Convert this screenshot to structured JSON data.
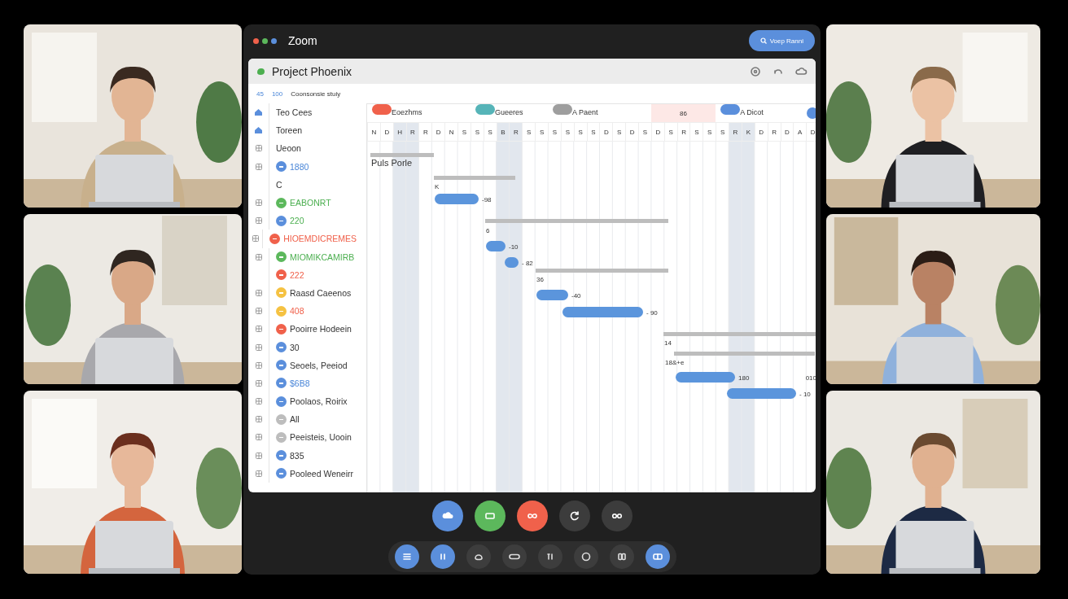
{
  "app": {
    "title": "Zoom",
    "action_button": "Voep Ranni"
  },
  "project": {
    "title": "Project Phoenix",
    "breadcrumb": [
      {
        "text": "45",
        "kind": "link"
      },
      {
        "text": "100",
        "kind": "link"
      },
      {
        "text": "Coonsonsie stuiy",
        "kind": "plain"
      }
    ]
  },
  "task_list": [
    {
      "label": "Teo Cees",
      "kind": "plain",
      "icon": true
    },
    {
      "label": "Toreen",
      "kind": "plain",
      "icon": true
    },
    {
      "label": "Ueoon",
      "kind": "plain",
      "icon": true
    },
    {
      "label": "1880",
      "kind": "link",
      "icon": true,
      "color": "#5b8fdc"
    },
    {
      "label": "C",
      "kind": "plain",
      "icon": false
    },
    {
      "label": "EABONRT",
      "kind": "success",
      "icon": true,
      "color": "#5cb85c"
    },
    {
      "label": "220",
      "kind": "success",
      "icon": true,
      "color": "#5b8fdc"
    },
    {
      "label": "HIOEMDICREMES",
      "kind": "alert",
      "icon": true,
      "color": "#f0614b"
    },
    {
      "label": "MIOMIKCAMIRB",
      "kind": "success",
      "icon": true,
      "color": "#5cb85c"
    },
    {
      "label": "222",
      "kind": "alert",
      "icon": false,
      "color": "#f0614b"
    },
    {
      "label": "Raasd Caeenos",
      "kind": "plain",
      "icon": true,
      "color": "#f5c242"
    },
    {
      "label": "408",
      "kind": "alert",
      "icon": true,
      "color": "#f5c242"
    },
    {
      "label": "Pooirre Hodeein",
      "kind": "plain",
      "icon": true,
      "color": "#f0614b"
    },
    {
      "label": "30",
      "kind": "plain",
      "icon": true,
      "color": "#5b8fdc"
    },
    {
      "label": "Seoels, Peeiod",
      "kind": "plain",
      "icon": true,
      "color": "#5b8fdc"
    },
    {
      "label": "$6B8",
      "kind": "link",
      "icon": true,
      "color": "#5b8fdc"
    },
    {
      "label": "Poolaos, Roirix",
      "kind": "plain",
      "icon": true,
      "color": "#5b8fdc"
    },
    {
      "label": "All",
      "kind": "plain",
      "icon": true,
      "color": "#bdbdbd"
    },
    {
      "label": "Peeisteis, Uooin",
      "kind": "plain",
      "icon": true,
      "color": "#bdbdbd"
    },
    {
      "label": "835",
      "kind": "plain",
      "icon": true,
      "color": "#5b8fdc"
    },
    {
      "label": "Pooleed Weneirr",
      "kind": "plain",
      "icon": true,
      "color": "#5b8fdc"
    }
  ],
  "gantt": {
    "groups": [
      {
        "kind": "pill",
        "label": "Eoezhms",
        "color": "#f0614b"
      },
      {
        "kind": "pill",
        "label": "Gueeres",
        "color": "#56b4b8"
      },
      {
        "kind": "pill",
        "label": "A Paent",
        "color": "#9e9e9e"
      },
      {
        "kind": "highlight",
        "label": "86"
      },
      {
        "kind": "pill",
        "label": "A Dicot",
        "color": "#5b8fdc"
      },
      {
        "kind": "dot",
        "color": "#5b8fdc"
      }
    ],
    "days": [
      {
        "label": "N",
        "weekend": false
      },
      {
        "label": "D",
        "weekend": false
      },
      {
        "label": "H",
        "weekend": true
      },
      {
        "label": "R",
        "weekend": true
      },
      {
        "label": "R",
        "weekend": false
      },
      {
        "label": "D",
        "weekend": false
      },
      {
        "label": "N",
        "weekend": false
      },
      {
        "label": "S",
        "weekend": false
      },
      {
        "label": "S",
        "weekend": false
      },
      {
        "label": "S",
        "weekend": false
      },
      {
        "label": "B",
        "weekend": true
      },
      {
        "label": "R",
        "weekend": true
      },
      {
        "label": "S",
        "weekend": false
      },
      {
        "label": "S",
        "weekend": false
      },
      {
        "label": "S",
        "weekend": false
      },
      {
        "label": "S",
        "weekend": false
      },
      {
        "label": "S",
        "weekend": false
      },
      {
        "label": "S",
        "weekend": false
      },
      {
        "label": "D",
        "weekend": false
      },
      {
        "label": "S",
        "weekend": false
      },
      {
        "label": "D",
        "weekend": false
      },
      {
        "label": "S",
        "weekend": false
      },
      {
        "label": "D",
        "weekend": false
      },
      {
        "label": "S",
        "weekend": false
      },
      {
        "label": "R",
        "weekend": false
      },
      {
        "label": "S",
        "weekend": false
      },
      {
        "label": "S",
        "weekend": false
      },
      {
        "label": "S",
        "weekend": false
      },
      {
        "label": "R",
        "weekend": true
      },
      {
        "label": "K",
        "weekend": true
      },
      {
        "label": "D",
        "weekend": false
      },
      {
        "label": "R",
        "weekend": false
      },
      {
        "label": "D",
        "weekend": false
      },
      {
        "label": "A",
        "weekend": false
      },
      {
        "label": "D",
        "weekend": false
      }
    ],
    "tasks": [
      {
        "kind": "summary",
        "label": "Puls Porle"
      },
      {
        "kind": "summary",
        "label": "K"
      },
      {
        "kind": "task",
        "label": "-98"
      },
      {
        "kind": "summary",
        "label": "6"
      },
      {
        "kind": "task",
        "label": "-10"
      },
      {
        "kind": "task",
        "label": "- 82"
      },
      {
        "kind": "summary",
        "label": "36"
      },
      {
        "kind": "task",
        "label": "-40"
      },
      {
        "kind": "task",
        "label": "- 90"
      },
      {
        "kind": "summary",
        "label": "14"
      },
      {
        "kind": "summary",
        "label": "18&+e"
      },
      {
        "kind": "task",
        "label": "180",
        "note": "010"
      },
      {
        "kind": "task",
        "label": "- 10"
      }
    ]
  },
  "call_controls": [
    {
      "color": "#5b8fdc"
    },
    {
      "color": "#5cb85c"
    },
    {
      "color": "#f0614b"
    },
    {
      "color": "#3c3c3c"
    },
    {
      "color": "#3c3c3c"
    }
  ],
  "toolbar": [
    {
      "active": true
    },
    {
      "active": true
    },
    {
      "active": false
    },
    {
      "active": false
    },
    {
      "active": false
    },
    {
      "active": false
    },
    {
      "active": false
    },
    {
      "active": true
    }
  ]
}
